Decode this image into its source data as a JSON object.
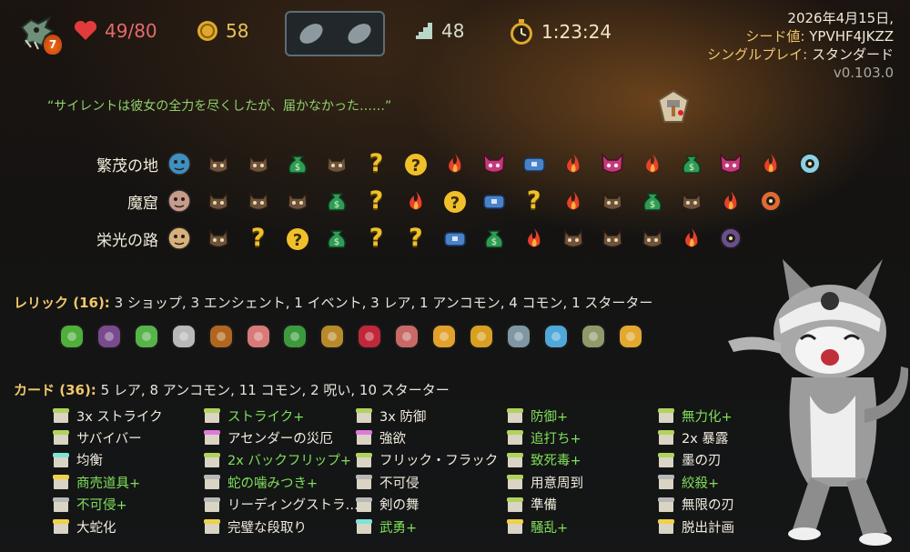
{
  "top_bar": {
    "character_icon": "dragon-skull-icon",
    "ascension": "7",
    "hp": "49/80",
    "gold": "58",
    "potions": [
      "empty-potion-slot",
      "empty-potion-slot"
    ],
    "floor": "48",
    "time": "1:23:24",
    "date": "2026年4月15日,",
    "seed_label": "シード値:",
    "seed_value": "YPVHF4JKZZ",
    "mode_label": "シングルプレイ:",
    "mode_value": "スタンダード",
    "version": "v0.103.0"
  },
  "quote": "“サイレントは彼女の全力を尽くしたが、届かなかった……”",
  "death_icon": "defeat-marker-icon",
  "acts": [
    {
      "name": "繁茂の地",
      "nodes": [
        "ancient",
        "monster",
        "monster",
        "merchant",
        "monster",
        "unknown",
        "treasure-unknown",
        "rest",
        "elite",
        "chest",
        "rest",
        "elite",
        "rest",
        "merchant",
        "elite",
        "rest",
        "boss"
      ]
    },
    {
      "name": "魔窟",
      "nodes": [
        "ancient",
        "monster",
        "monster",
        "monster",
        "merchant",
        "unknown",
        "rest",
        "treasure-unknown",
        "chest",
        "unknown",
        "rest",
        "monster",
        "merchant",
        "monster",
        "rest",
        "boss"
      ]
    },
    {
      "name": "栄光の路",
      "nodes": [
        "ancient",
        "monster",
        "unknown",
        "treasure-unknown",
        "merchant",
        "unknown",
        "unknown",
        "chest",
        "merchant",
        "rest",
        "monster",
        "monster",
        "monster",
        "rest",
        "boss"
      ]
    }
  ],
  "relics": {
    "title": "レリック (16):",
    "summary": "3 ショップ,  3 エンシェント,  1 イベント,  3 レア,  1 アンコモン,  4 コモン,  1 スターター",
    "items": [
      "ring-of-the-snake-icon",
      "purple-orb-icon",
      "green-card-icon",
      "tuning-fork-icon",
      "wooden-box-icon",
      "flying-bird-icon",
      "lantern-icon",
      "wax-seal-icon",
      "red-cushion-icon",
      "meat-icon",
      "orrery-icon",
      "golden-disc-icon",
      "trident-icon",
      "blue-spirit-icon",
      "newtons-cradle-icon",
      "vajra-icon"
    ]
  },
  "cards": {
    "title": "カード (36):",
    "summary": "5 レア,  8 アンコモン,  11 コモン,  2 呪い,  10 スターター",
    "columns": [
      [
        {
          "name": "3x ストライク",
          "color": "#b0d35c",
          "upgraded": false
        },
        {
          "name": "サバイバー",
          "color": "#b0d35c",
          "upgraded": false
        },
        {
          "name": "均衡",
          "color": "#7fe3d8",
          "upgraded": false
        },
        {
          "name": "商売道具+",
          "color": "#f0d24a",
          "upgraded": true
        },
        {
          "name": "不可侵+",
          "color": "#b8b8b8",
          "upgraded": true
        },
        {
          "name": "大蛇化",
          "color": "#f0d24a",
          "upgraded": false
        }
      ],
      [
        {
          "name": "ストライク+",
          "color": "#b0d35c",
          "upgraded": true
        },
        {
          "name": "アセンダーの災厄",
          "color": "#e07ad8",
          "upgraded": false
        },
        {
          "name": "2x バックフリップ+",
          "color": "#b0d35c",
          "upgraded": true
        },
        {
          "name": "蛇の噛みつき+",
          "color": "#b8b8b8",
          "upgraded": true
        },
        {
          "name": "リーディングストラ…",
          "color": "#b8b8b8",
          "upgraded": false
        },
        {
          "name": "完璧な段取り",
          "color": "#f0d24a",
          "upgraded": false
        }
      ],
      [
        {
          "name": "3x 防御",
          "color": "#b0d35c",
          "upgraded": false
        },
        {
          "name": "強欲",
          "color": "#e07ad8",
          "upgraded": false
        },
        {
          "name": "フリック・フラック",
          "color": "#b0d35c",
          "upgraded": false
        },
        {
          "name": "不可侵",
          "color": "#b8b8b8",
          "upgraded": false
        },
        {
          "name": "剣の舞",
          "color": "#b8b8b8",
          "upgraded": false
        },
        {
          "name": "武勇+",
          "color": "#7fe3d8",
          "upgraded": true
        }
      ],
      [
        {
          "name": "防御+",
          "color": "#b0d35c",
          "upgraded": true
        },
        {
          "name": "追打ち+",
          "color": "#b0d35c",
          "upgraded": true
        },
        {
          "name": "致死毒+",
          "color": "#b0d35c",
          "upgraded": true
        },
        {
          "name": "用意周到",
          "color": "#b0d35c",
          "upgraded": false
        },
        {
          "name": "準備",
          "color": "#b0d35c",
          "upgraded": false
        },
        {
          "name": "騒乱+",
          "color": "#f0d24a",
          "upgraded": true
        }
      ],
      [
        {
          "name": "無力化+",
          "color": "#b0d35c",
          "upgraded": true
        },
        {
          "name": "2x 暴露",
          "color": "#b0d35c",
          "upgraded": false
        },
        {
          "name": "墨の刃",
          "color": "#b0d35c",
          "upgraded": false
        },
        {
          "name": "絞殺+",
          "color": "#b8b8b8",
          "upgraded": true
        },
        {
          "name": "無限の刃",
          "color": "#b8b8b8",
          "upgraded": false
        },
        {
          "name": "脱出計画",
          "color": "#f0d24a",
          "upgraded": false
        }
      ]
    ]
  },
  "mascot_icon": "cat-mascot-icon"
}
